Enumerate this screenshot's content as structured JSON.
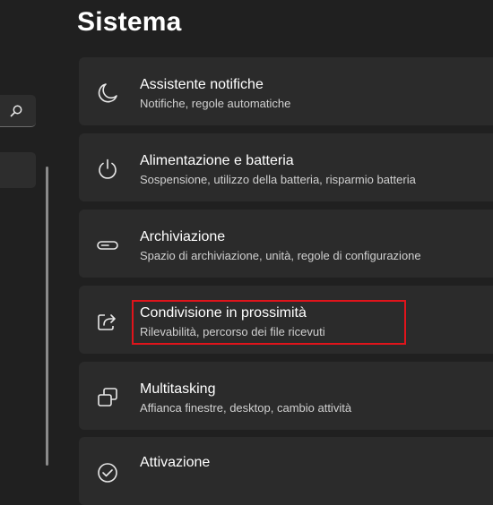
{
  "page_title": "Sistema",
  "items": [
    {
      "title": "Assistente notifiche",
      "subtitle": "Notifiche, regole automatiche",
      "icon": "moon-icon"
    },
    {
      "title": "Alimentazione e batteria",
      "subtitle": "Sospensione, utilizzo della batteria, risparmio batteria",
      "icon": "power-icon"
    },
    {
      "title": "Archiviazione",
      "subtitle": "Spazio di archiviazione, unità, regole di configurazione",
      "icon": "storage-drive-icon"
    },
    {
      "title": "Condivisione in prossimità",
      "subtitle": "Rilevabilità, percorso dei file ricevuti",
      "icon": "share-icon"
    },
    {
      "title": "Multitasking",
      "subtitle": "Affianca finestre, desktop, cambio attività",
      "icon": "multitasking-icon"
    },
    {
      "title": "Attivazione",
      "subtitle": "",
      "icon": "activation-icon"
    }
  ],
  "colors": {
    "background": "#202020",
    "card": "#2b2b2b",
    "highlight": "#e0141b"
  }
}
